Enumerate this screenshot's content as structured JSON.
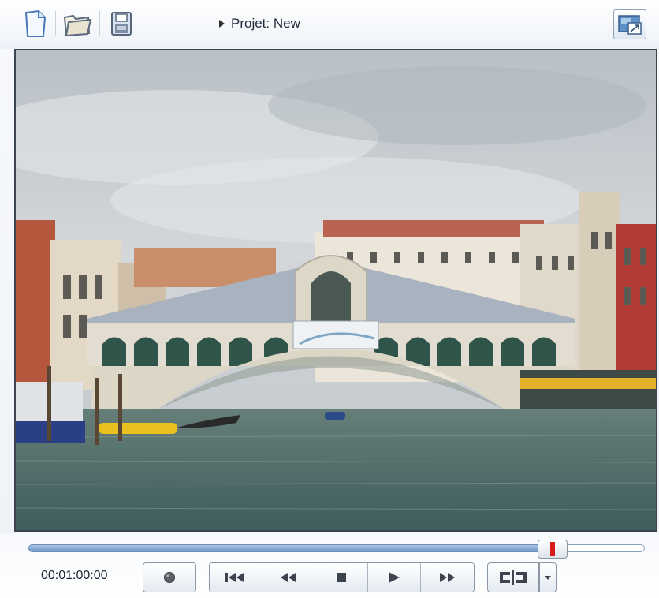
{
  "toolbar": {
    "project_label": "Projet: New",
    "icons": [
      "new-document-icon",
      "open-folder-icon",
      "save-disk-icon",
      "fullscreen-icon"
    ]
  },
  "preview": {
    "content": "photo",
    "colors": {
      "sky": "#c9ced3",
      "water": "#4d6d6b",
      "bridge": "#d8d3c5"
    }
  },
  "player": {
    "timecode": "00:01:00:00",
    "progress": 0.85,
    "colors": {
      "fill": "#7fa6d6",
      "marker": "#d81a1a"
    }
  },
  "transport": {
    "icons": [
      "record-icon",
      "skip-to-start-icon",
      "rewind-icon",
      "stop-icon",
      "play-icon",
      "fast-forward-icon",
      "split-icon",
      "dropdown-arrow-icon"
    ]
  }
}
